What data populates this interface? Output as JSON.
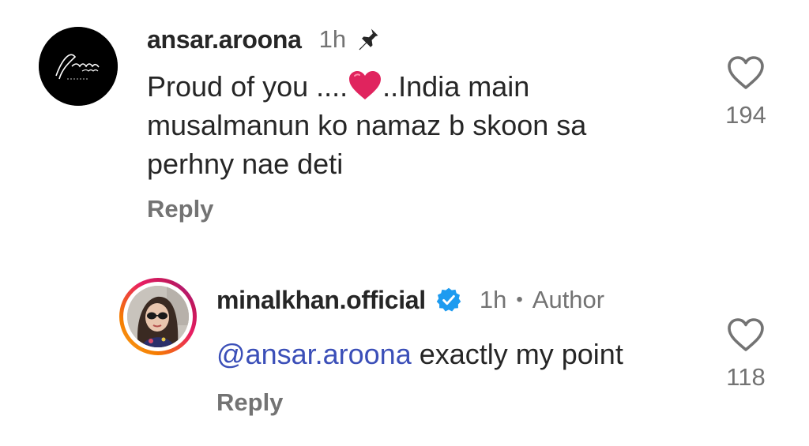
{
  "comments": [
    {
      "username": "ansar.aroona",
      "time": "1h",
      "pinned": true,
      "avatar_logo_text": "Arona",
      "text_before": "Proud of you ....",
      "emoji": "red-heart",
      "text_after": "..India main musalmanun ko namaz b skoon sa perhny nae deti",
      "reply_label": "Reply",
      "like_count": "194",
      "icons": {
        "pin": "pin-icon",
        "like": "heart-outline-icon"
      }
    },
    {
      "username": "minalkhan.official",
      "verified": true,
      "time": "1h",
      "separator": "•",
      "badge": "Author",
      "mention": "@ansar.aroona",
      "text": " exactly my point",
      "reply_label": "Reply",
      "like_count": "118",
      "icons": {
        "verified": "verified-badge-icon",
        "like": "heart-outline-icon"
      }
    }
  ],
  "colors": {
    "text": "#262626",
    "muted": "#737373",
    "mention": "#3b4fb8",
    "verified": "#1d9bf0",
    "heart": "#e0245e"
  }
}
